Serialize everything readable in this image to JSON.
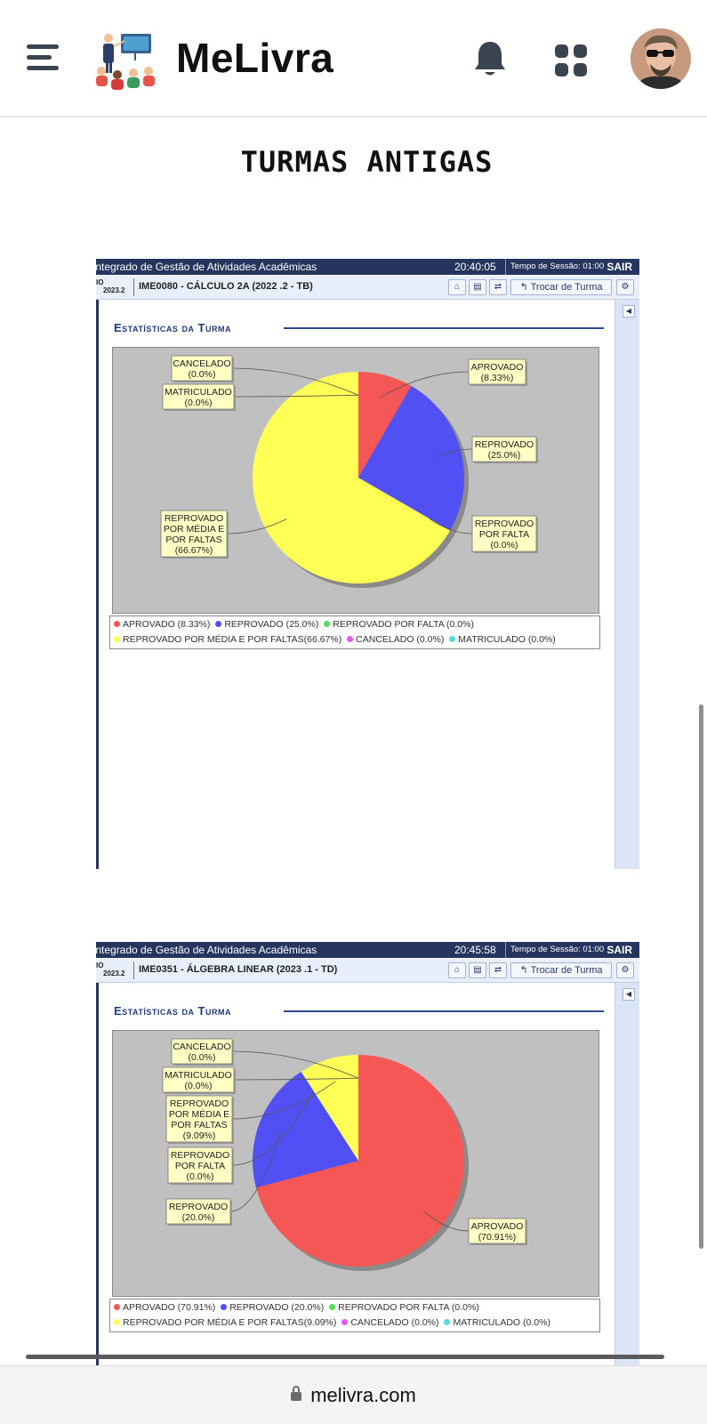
{
  "appbar": {
    "brand": "MeLivra",
    "icons": [
      "menu-icon",
      "teacher-logo-icon",
      "bell-icon",
      "apps-grid-icon",
      "user-avatar"
    ]
  },
  "page": {
    "title": "TURMAS ANTIGAS"
  },
  "colors": {
    "aprovado": "#f55656",
    "reprovado": "#5050f5",
    "reprovado_por_falta": "#55dd55",
    "reprovado_media_faltas": "#ffff55",
    "cancelado": "#ee55ee",
    "matriculado": "#55dddd",
    "chart_bg": "#c0c0c0",
    "header_navy": "#25355e"
  },
  "screenshots": [
    {
      "system_name": "Integrado de Gestão de Atividades Acadêmicas",
      "clock": "20:40:05",
      "session_label": "Tempo de Sessão: 01:00",
      "exit_label": "SAIR",
      "semester_top": "IO",
      "semester_bottom": "2023.2",
      "course": "IME0080 - CÁLCULO 2A (2022 .2 - TB)",
      "trocar_label": "↰ Trocar de Turma",
      "section_title": "Estatísticas da Turma",
      "legend_row1": [
        {
          "label": "APROVADO (8.33%)",
          "color": "#f55656"
        },
        {
          "label": "REPROVADO (25.0%)",
          "color": "#5050f5"
        },
        {
          "label": "REPROVADO POR FALTA (0.0%)",
          "color": "#55dd55"
        }
      ],
      "legend_row2": [
        {
          "label": "REPROVADO POR MÉDIA E POR FALTAS(66.67%)",
          "color": "#ffff55"
        },
        {
          "label": "CANCELADO (0.0%)",
          "color": "#ee55ee"
        },
        {
          "label": "MATRICULADO (0.0%)",
          "color": "#55dddd"
        }
      ]
    },
    {
      "system_name": "Integrado de Gestão de Atividades Acadêmicas",
      "clock": "20:45:58",
      "session_label": "Tempo de Sessão: 01:00",
      "exit_label": "SAIR",
      "semester_top": "IO",
      "semester_bottom": "2023.2",
      "course": "IME0351 - ÁLGEBRA LINEAR (2023 .1 - TD)",
      "trocar_label": "↰ Trocar de Turma",
      "section_title": "Estatísticas da Turma",
      "legend_row1": [
        {
          "label": "APROVADO (70.91%)",
          "color": "#f55656"
        },
        {
          "label": "REPROVADO (20.0%)",
          "color": "#5050f5"
        },
        {
          "label": "REPROVADO POR FALTA (0.0%)",
          "color": "#55dd55"
        }
      ],
      "legend_row2": [
        {
          "label": "REPROVADO POR MÉDIA E POR FALTAS(9.09%)",
          "color": "#ffff55"
        },
        {
          "label": "CANCELADO (0.0%)",
          "color": "#ee55ee"
        },
        {
          "label": "MATRICULADO (0.0%)",
          "color": "#55dddd"
        }
      ]
    }
  ],
  "chart_data": [
    {
      "type": "pie",
      "title": "Estatísticas da Turma",
      "categories": [
        "APROVADO",
        "REPROVADO",
        "REPROVADO POR FALTA",
        "REPROVADO POR MÉDIA E POR FALTAS",
        "CANCELADO",
        "MATRICULADO"
      ],
      "values": [
        8.33,
        25.0,
        0.0,
        66.67,
        0.0,
        0.0
      ],
      "colors": [
        "#f55656",
        "#5050f5",
        "#55dd55",
        "#ffff55",
        "#ee55ee",
        "#55dddd"
      ],
      "slice_labels": [
        "APROVADO\n(8.33%)",
        "REPROVADO\n(25.0%)",
        "REPROVADO\nPOR FALTA\n(0.0%)",
        "REPROVADO\nPOR MÉDIA E\nPOR FALTAS\n(66.67%)",
        "CANCELADO\n(0.0%)",
        "MATRICULADO\n(0.0%)"
      ],
      "legend_position": "bottom"
    },
    {
      "type": "pie",
      "title": "Estatísticas da Turma",
      "categories": [
        "APROVADO",
        "REPROVADO",
        "REPROVADO POR FALTA",
        "REPROVADO POR MÉDIA E POR FALTAS",
        "CANCELADO",
        "MATRICULADO"
      ],
      "values": [
        70.91,
        20.0,
        0.0,
        9.09,
        0.0,
        0.0
      ],
      "colors": [
        "#f55656",
        "#5050f5",
        "#55dd55",
        "#ffff55",
        "#ee55ee",
        "#55dddd"
      ],
      "slice_labels": [
        "APROVADO\n(70.91%)",
        "REPROVADO\n(20.0%)",
        "REPROVADO\nPOR FALTA\n(0.0%)",
        "REPROVADO\nPOR MÉDIA E\nPOR FALTAS\n(9.09%)",
        "CANCELADO\n(0.0%)",
        "MATRICULADO\n(0.0%)"
      ],
      "legend_position": "bottom"
    }
  ],
  "browser": {
    "url": "melivra.com"
  }
}
